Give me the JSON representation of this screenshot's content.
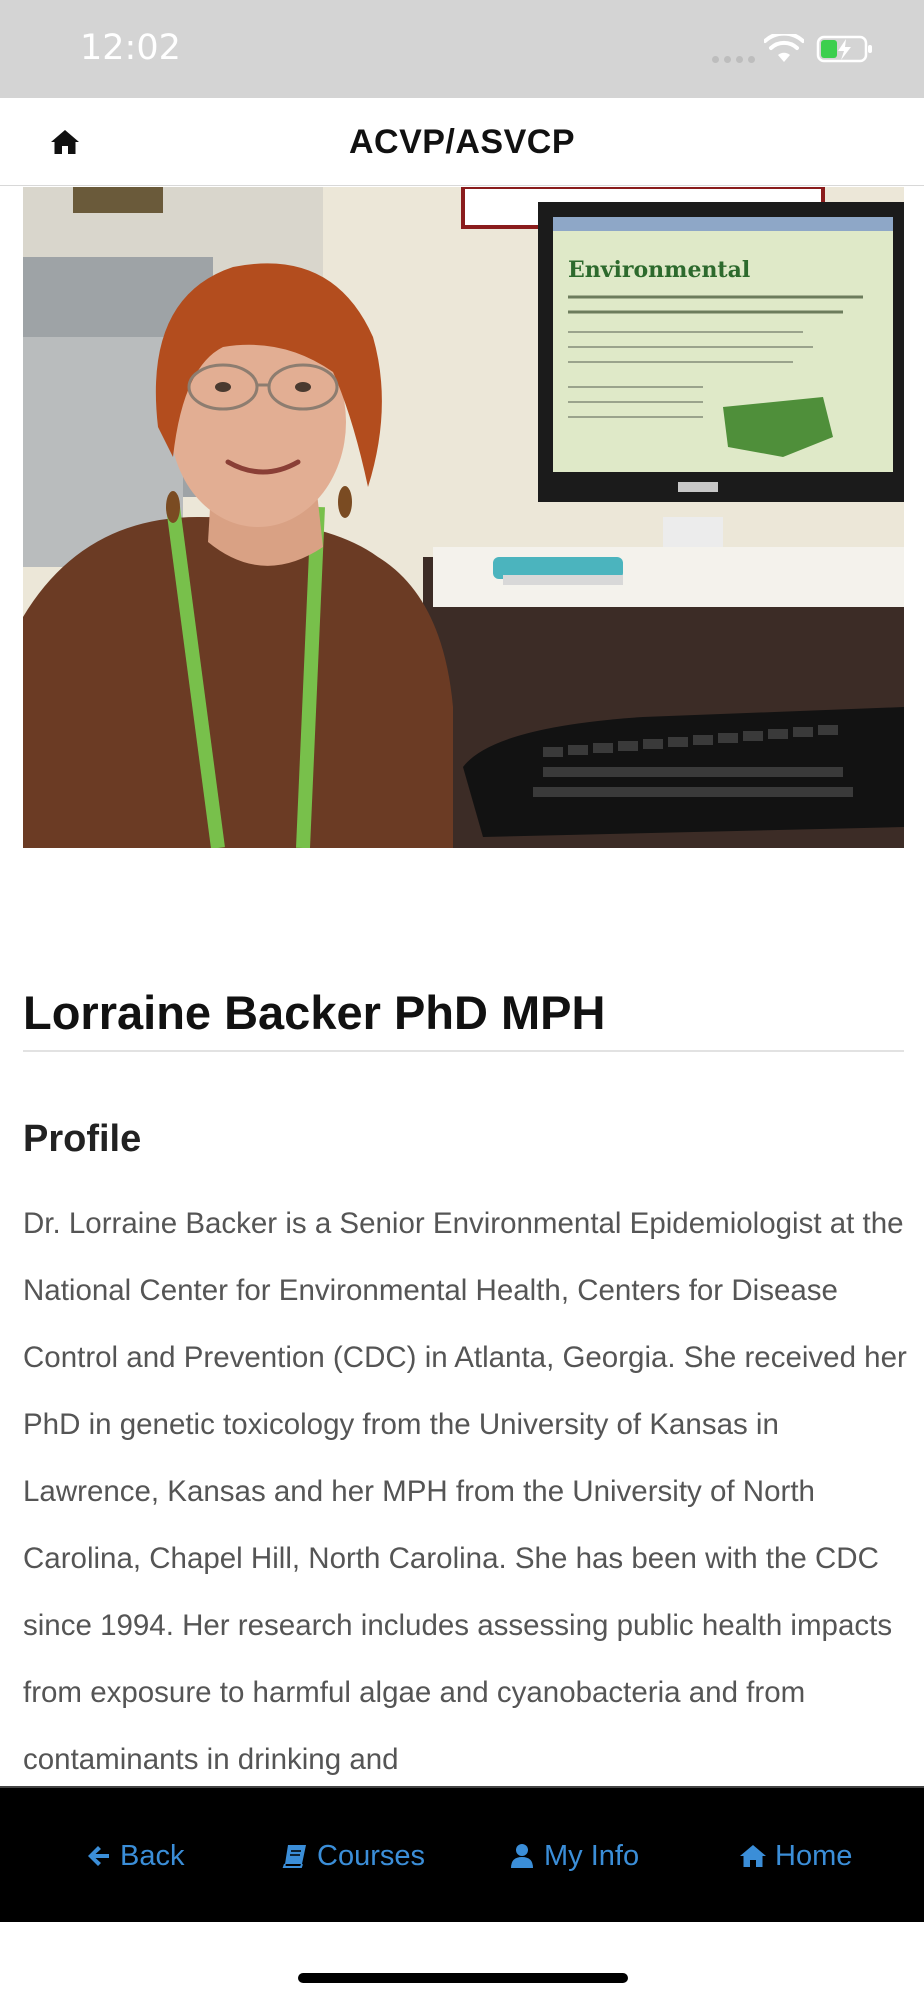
{
  "status_bar": {
    "time": "12:02"
  },
  "header": {
    "title": "ACVP/ASVCP"
  },
  "speaker": {
    "name": "Lorraine Backer PhD MPH",
    "section_heading": "Profile",
    "bio": "Dr. Lorraine Backer is a Senior Environmental Epidemiologist at the National Center for Environmental Health, Centers for Disease Control and Prevention (CDC) in Atlanta, Georgia. She received her PhD in genetic toxicology from the University of Kansas in Lawrence, Kansas and her MPH from the University of North Carolina, Chapel Hill, North Carolina. She has been with the CDC since 1994. Her research includes assessing public health impacts from exposure to harmful algae and cyanobacteria and from contaminants in drinking and"
  },
  "tab_bar": {
    "back_label": "Back",
    "courses_label": "Courses",
    "myinfo_label": "My Info",
    "home_label": "Home"
  },
  "colors": {
    "accent": "#3b8ed8",
    "status_bar_bg": "#d4d4d4",
    "tab_bar_bg": "#000000",
    "body_text": "#555555"
  },
  "icons": {
    "header_home": "home-icon",
    "back": "arrow-left-icon",
    "courses": "book-icon",
    "my_info": "user-icon",
    "home": "home-icon"
  }
}
